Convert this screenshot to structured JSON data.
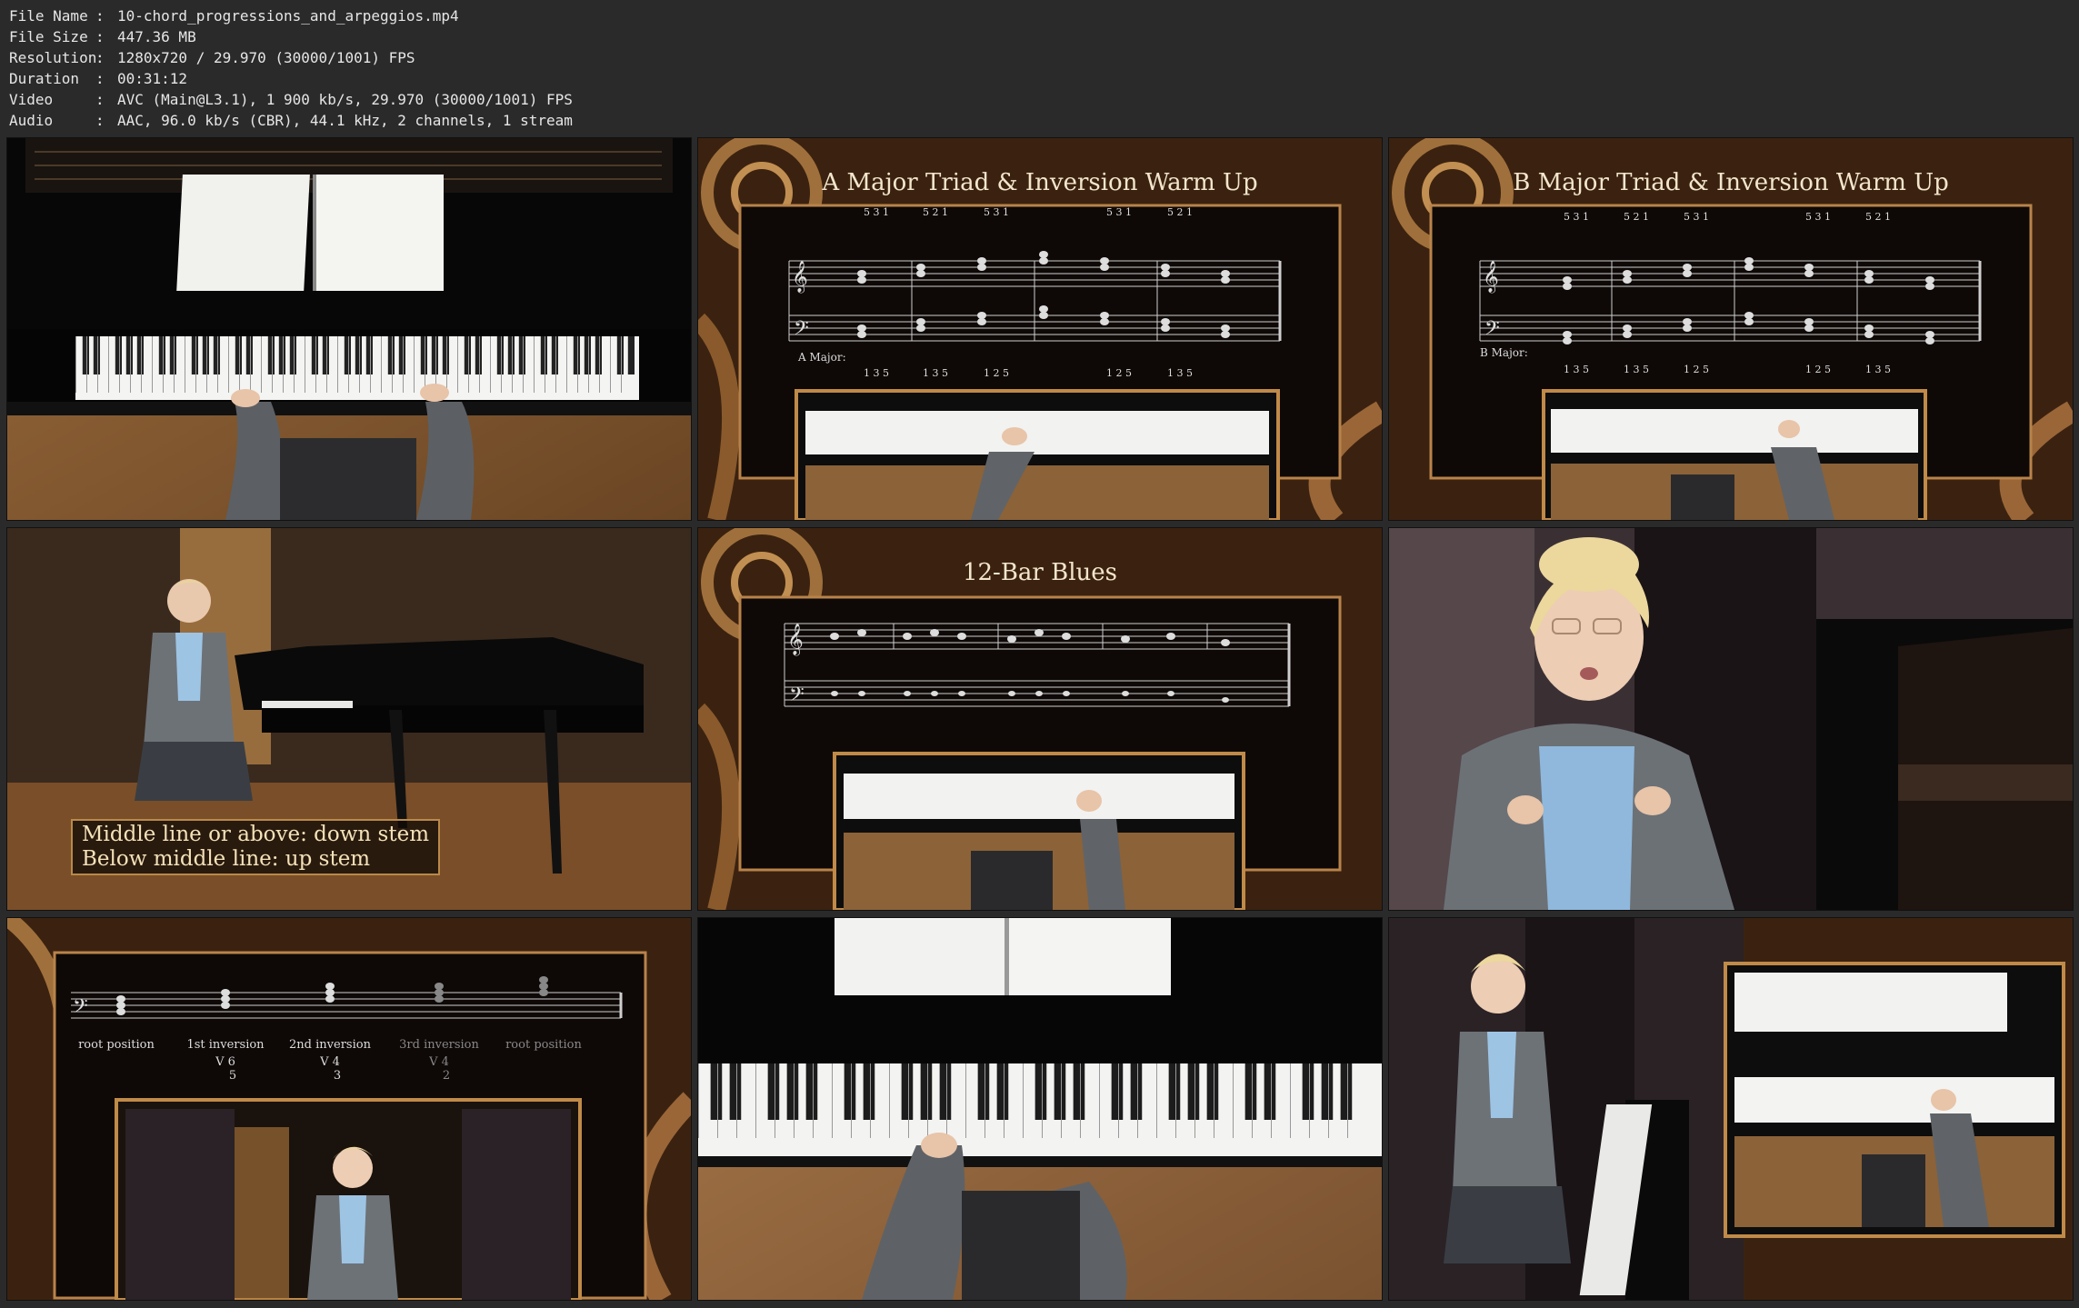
{
  "metadata": [
    {
      "key": "File Name",
      "value": "10-chord_progressions_and_arpeggios.mp4"
    },
    {
      "key": "File Size",
      "value": "447.36 MB"
    },
    {
      "key": "Resolution",
      "value": "1280x720 / 29.970 (30000/1001) FPS"
    },
    {
      "key": "Duration",
      "value": "00:31:12"
    },
    {
      "key": "Video",
      "value": "AVC (Main@L3.1), 1 900 kb/s, 29.970 (30000/1001) FPS"
    },
    {
      "key": "Audio",
      "value": "AAC, 96.0 kb/s (CBR), 44.1 kHz, 2 channels, 1 stream"
    }
  ],
  "separator": ":",
  "thumbnails": {
    "a_major": {
      "title": "A Major Triad & Inversion Warm Up",
      "chord_label": "A Major:",
      "top_fingering": [
        "5 3 1",
        "5 2 1",
        "5 3 1",
        "",
        "5 3 1",
        "5 2 1"
      ],
      "bottom_fingering": [
        "1 3 5",
        "1 3 5",
        "1 2 5",
        "",
        "1 2 5",
        "1 3 5"
      ]
    },
    "b_major": {
      "title": "B Major Triad & Inversion Warm Up",
      "chord_label": "B Major:",
      "top_fingering": [
        "5 3 1",
        "5 2 1",
        "5 3 1",
        "",
        "5 3 1",
        "5 2 1"
      ],
      "bottom_fingering": [
        "1 3 5",
        "1 3 5",
        "1 2 5",
        "",
        "1 2 5",
        "1 3 5"
      ]
    },
    "blues": {
      "title": "12-Bar Blues"
    },
    "stem_caption": {
      "line1": "Middle line or above: down stem",
      "line2": "Below middle line: up stem"
    },
    "inversions": {
      "labels": [
        "root position",
        "1st inversion",
        "2nd inversion",
        "3rd inversion",
        "root position"
      ],
      "figures": [
        "",
        "V 6\n5",
        "V 4\n3",
        "V 4\n2",
        ""
      ]
    }
  },
  "colors": {
    "background": "#2a2a2a",
    "text": "#e6e6e6",
    "frame_wood": "#5a3518",
    "frame_gold": "#c08a48",
    "panel": "#0e0907",
    "caption_text": "#f4e2b8"
  }
}
